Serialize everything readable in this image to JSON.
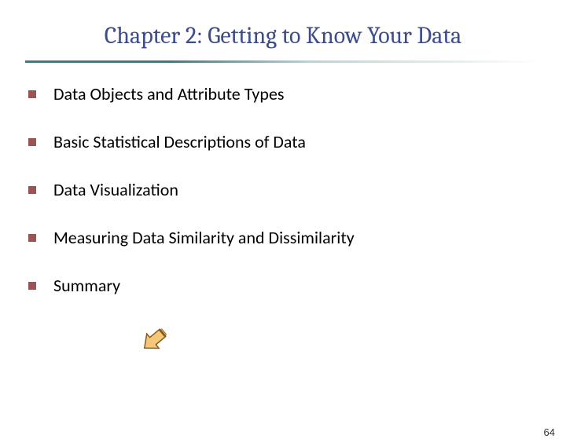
{
  "title": "Chapter 2: Getting to Know Your Data",
  "bullets": [
    "Data Objects and Attribute Types",
    "Basic Statistical Descriptions of Data",
    "Data Visualization",
    "Measuring Data Similarity and Dissimilarity",
    "Summary"
  ],
  "page_number": "64"
}
